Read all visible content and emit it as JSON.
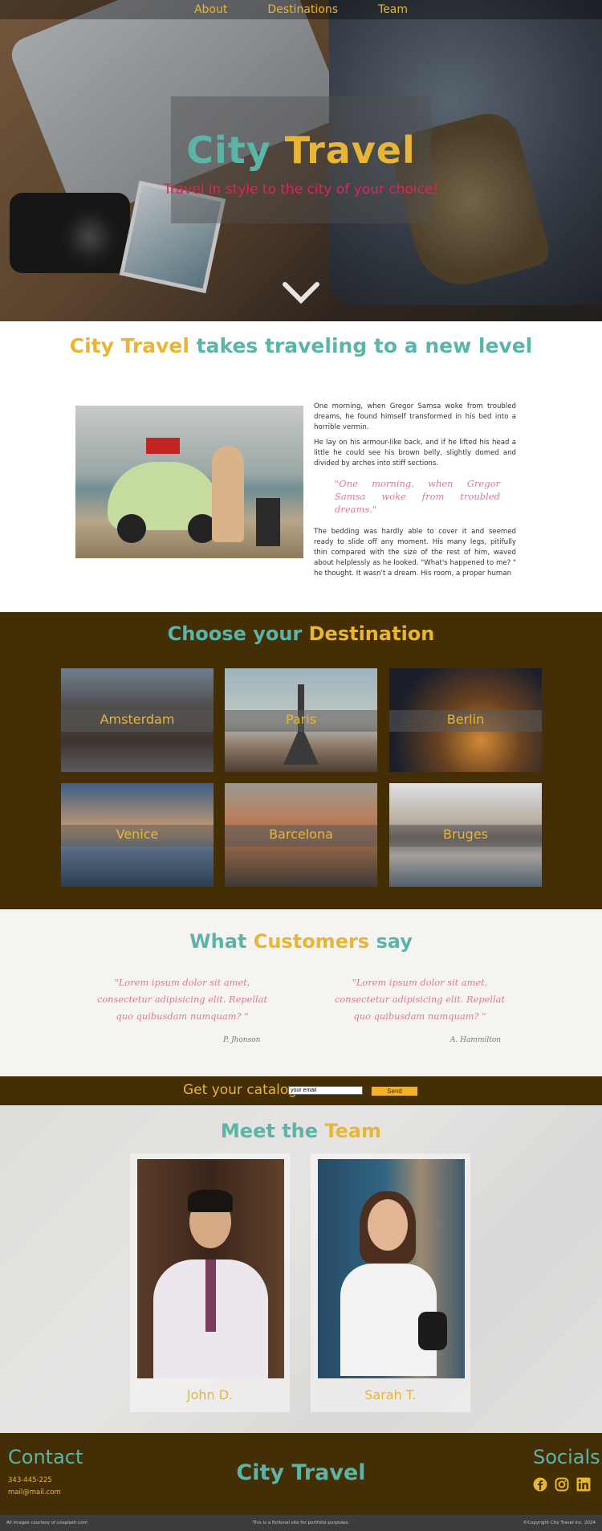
{
  "nav": {
    "items": [
      "About",
      "Destinations",
      "Team"
    ]
  },
  "hero": {
    "brand_part1": "City",
    "brand_part2": "Travel",
    "tagline": "Travel in style to the city of your choice!"
  },
  "intro": {
    "title_brand": "City Travel",
    "title_rest": "takes traveling to a new level",
    "paragraph1": "One morning, when Gregor Samsa woke from troubled dreams, he found himself transformed in his bed into a horrible vermin.",
    "paragraph2": "He lay on his armour-like back, and if he lifted his head a little he could see his brown belly, slightly domed and divided by arches into stiff sections.",
    "quote": "\"One morning, when Gregor Samsa woke from troubled dreams.\"",
    "paragraph3": "The bedding was hardly able to cover it and seemed ready to slide off any moment. His many legs, pitifully thin compared with the size of the rest of him, waved about helplessly as he looked. \"What's happened to me? \" he thought. It wasn't a dream. His room, a proper human"
  },
  "destinations": {
    "title_part1": "Choose your",
    "title_part2": "Destination",
    "cities": [
      "Amsterdam",
      "Paris",
      "Berlin",
      "Venice",
      "Barcelona",
      "Bruges"
    ]
  },
  "testimonials": {
    "title_part1": "What",
    "title_part2": "Customers",
    "title_part3": "say",
    "items": [
      {
        "quote": "\"Lorem ipsum dolor sit amet, consectetur adipisicing elit. Repellat quo quibusdam numquam? \"",
        "author": "P. Jhonson"
      },
      {
        "quote": "\"Lorem ipsum dolor sit amet, consectetur adipisicing elit. Repellat quo quibusdam numquam? \"",
        "author": "A. Hammilton"
      }
    ]
  },
  "catalog": {
    "label": "Get your catalog:",
    "input_value": "your email",
    "button": "Send"
  },
  "team": {
    "title_part1": "Meet the",
    "title_part2": "Team",
    "members": [
      "John D.",
      "Sarah T."
    ]
  },
  "footer": {
    "contact_title": "Contact",
    "phone": "343-445-225",
    "email": "mail@mail.com",
    "brand": "City Travel",
    "socials_title": "Socials",
    "social_icons": [
      "facebook-icon",
      "instagram-icon",
      "linkedin-icon"
    ]
  },
  "bottom_bar": {
    "left": "All images courtesy of unsplash.com",
    "center": "This is a fictional site for portfolio purposes.",
    "right": "©Copyright City Travel inc. 2024"
  },
  "colors": {
    "teal": "#5ab5a8",
    "gold": "#e8b634",
    "brown": "#442e06",
    "pink": "#d87a9a",
    "red": "#d6285a"
  }
}
